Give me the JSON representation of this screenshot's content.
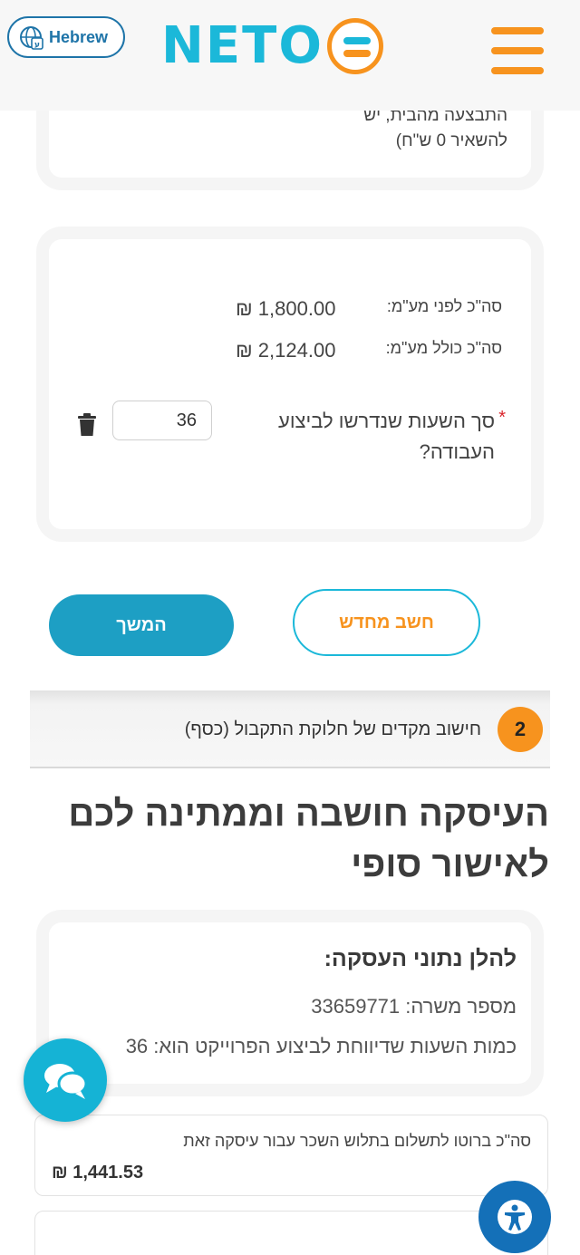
{
  "header": {
    "language_label": "Hebrew",
    "logo_text": "NETO",
    "colors": {
      "accent_blue": "#1bb8d9",
      "accent_orange": "#f7931e",
      "link_blue": "#1e74a8"
    }
  },
  "top_card": {
    "line1": "התבצעה מהבית, יש",
    "line2": "להשאיר 0 ש\"ח)"
  },
  "calc_card": {
    "subtotal_label": "סה\"כ לפני מע\"מ:",
    "subtotal_value": "₪ 1,800.00",
    "total_label": "סה\"כ כולל מע\"מ:",
    "total_value": "₪ 2,124.00",
    "required_mark": "*",
    "hours_question": "סך השעות שנדרשו לביצוע העבודה?",
    "hours_value": "36"
  },
  "buttons": {
    "continue_label": "המשך",
    "recalculate_label": "חשב מחדש"
  },
  "step": {
    "number": "2",
    "title": "חישוב מקדים של חלוקת התקבול (כסף)"
  },
  "summary": {
    "title": "העיסקה חושבה וממתינה לכם לאישור סופי",
    "details_title": "להלן נתוני העסקה:",
    "job_number": "מספר משרה: 33659771",
    "hours_reported": "כמות השעות שדיווחת לביצוע הפרוייקט הוא: 36"
  },
  "gross": {
    "label": "סה\"כ ברוטו לתשלום בתלוש השכר עבור עיסקה זאת",
    "value": "₪ 1,441.53"
  },
  "floating": {
    "chat_icon": "chat-bubbles-icon",
    "accessibility_icon": "accessibility-icon"
  }
}
